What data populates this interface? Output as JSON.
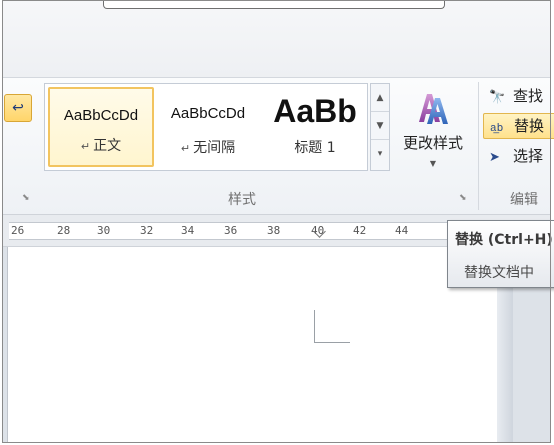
{
  "styles_gallery": {
    "items": [
      {
        "sample": "AaBbCcDd",
        "name": "正文",
        "selected": true
      },
      {
        "sample": "AaBbCcDd",
        "name": "无间隔",
        "selected": false
      },
      {
        "sample": "AaBb",
        "name": "标题 1",
        "selected": false
      }
    ],
    "para_mark": "↵"
  },
  "change_styles": {
    "label": "更改样式"
  },
  "editing": {
    "find_label": "查找",
    "replace_label": "替换",
    "select_label": "选择"
  },
  "group_labels": {
    "styles": "样式",
    "editing": "编辑"
  },
  "ruler": {
    "ticks": [
      "26",
      "28",
      "30",
      "32",
      "34",
      "36",
      "38",
      "40",
      "42",
      "44"
    ]
  },
  "tooltip": {
    "title": "替换 (Ctrl+H)",
    "description": "替换文档中"
  },
  "colors": {
    "ribbon_bg": "#eef1f5",
    "selected_highlight": "#f2c45f",
    "hover_highlight": "#ffe18c",
    "page": "#ffffff"
  }
}
